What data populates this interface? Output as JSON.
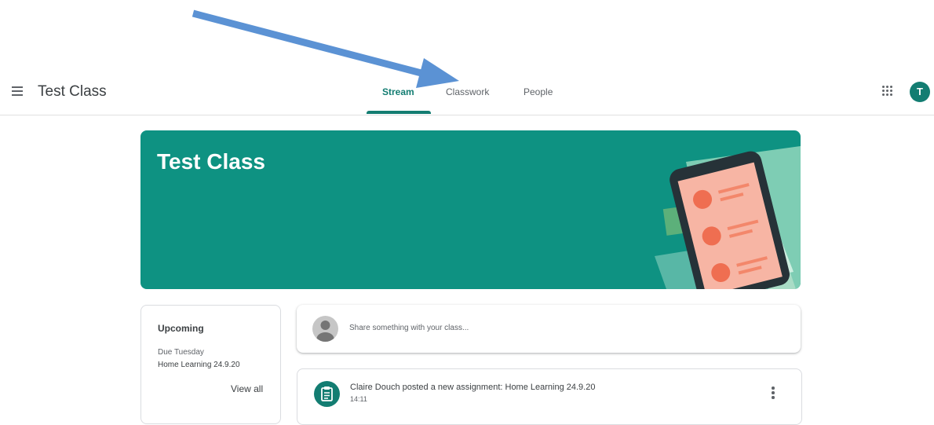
{
  "header": {
    "class_name": "Test Class",
    "tabs": [
      {
        "label": "Stream",
        "active": true
      },
      {
        "label": "Classwork",
        "active": false
      },
      {
        "label": "People",
        "active": false
      }
    ],
    "avatar_letter": "T"
  },
  "banner": {
    "title": "Test Class",
    "color": "#0e9282"
  },
  "upcoming": {
    "title": "Upcoming",
    "due_label": "Due Tuesday",
    "due_item": "Home Learning 24.9.20",
    "view_all": "View all"
  },
  "share": {
    "placeholder": "Share something with your class..."
  },
  "posts": [
    {
      "title": "Claire Douch posted a new assignment: Home Learning 24.9.20",
      "time": "14:11",
      "icon": "assignment-icon"
    }
  ],
  "colors": {
    "accent": "#137d72",
    "annotation_arrow": "#5b92d4"
  }
}
